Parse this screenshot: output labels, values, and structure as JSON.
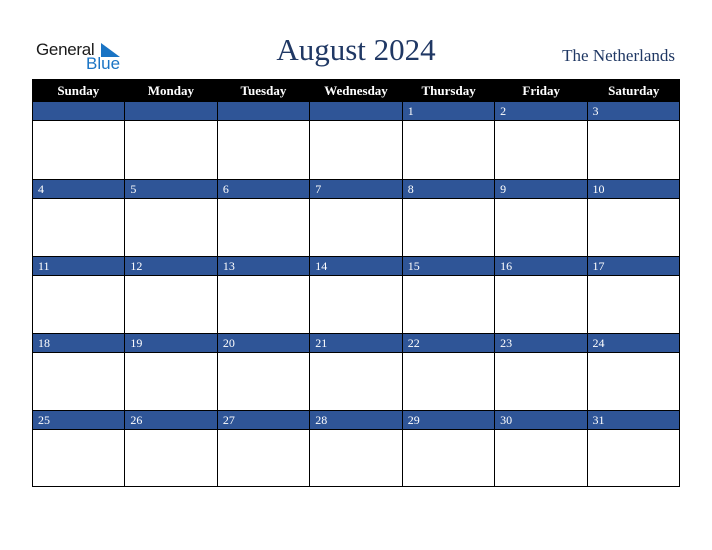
{
  "logo": {
    "line1": "General",
    "line2": "Blue"
  },
  "title": "August 2024",
  "country": "The Netherlands",
  "weekdays": [
    "Sunday",
    "Monday",
    "Tuesday",
    "Wednesday",
    "Thursday",
    "Friday",
    "Saturday"
  ],
  "weeks": [
    [
      "",
      "",
      "",
      "",
      "1",
      "2",
      "3"
    ],
    [
      "4",
      "5",
      "6",
      "7",
      "8",
      "9",
      "10"
    ],
    [
      "11",
      "12",
      "13",
      "14",
      "15",
      "16",
      "17"
    ],
    [
      "18",
      "19",
      "20",
      "21",
      "22",
      "23",
      "24"
    ],
    [
      "25",
      "26",
      "27",
      "28",
      "29",
      "30",
      "31"
    ]
  ],
  "colors": {
    "header_bg": "#000000",
    "day_bar": "#2f5597",
    "title": "#203864",
    "logo_blue": "#1a74c4"
  }
}
